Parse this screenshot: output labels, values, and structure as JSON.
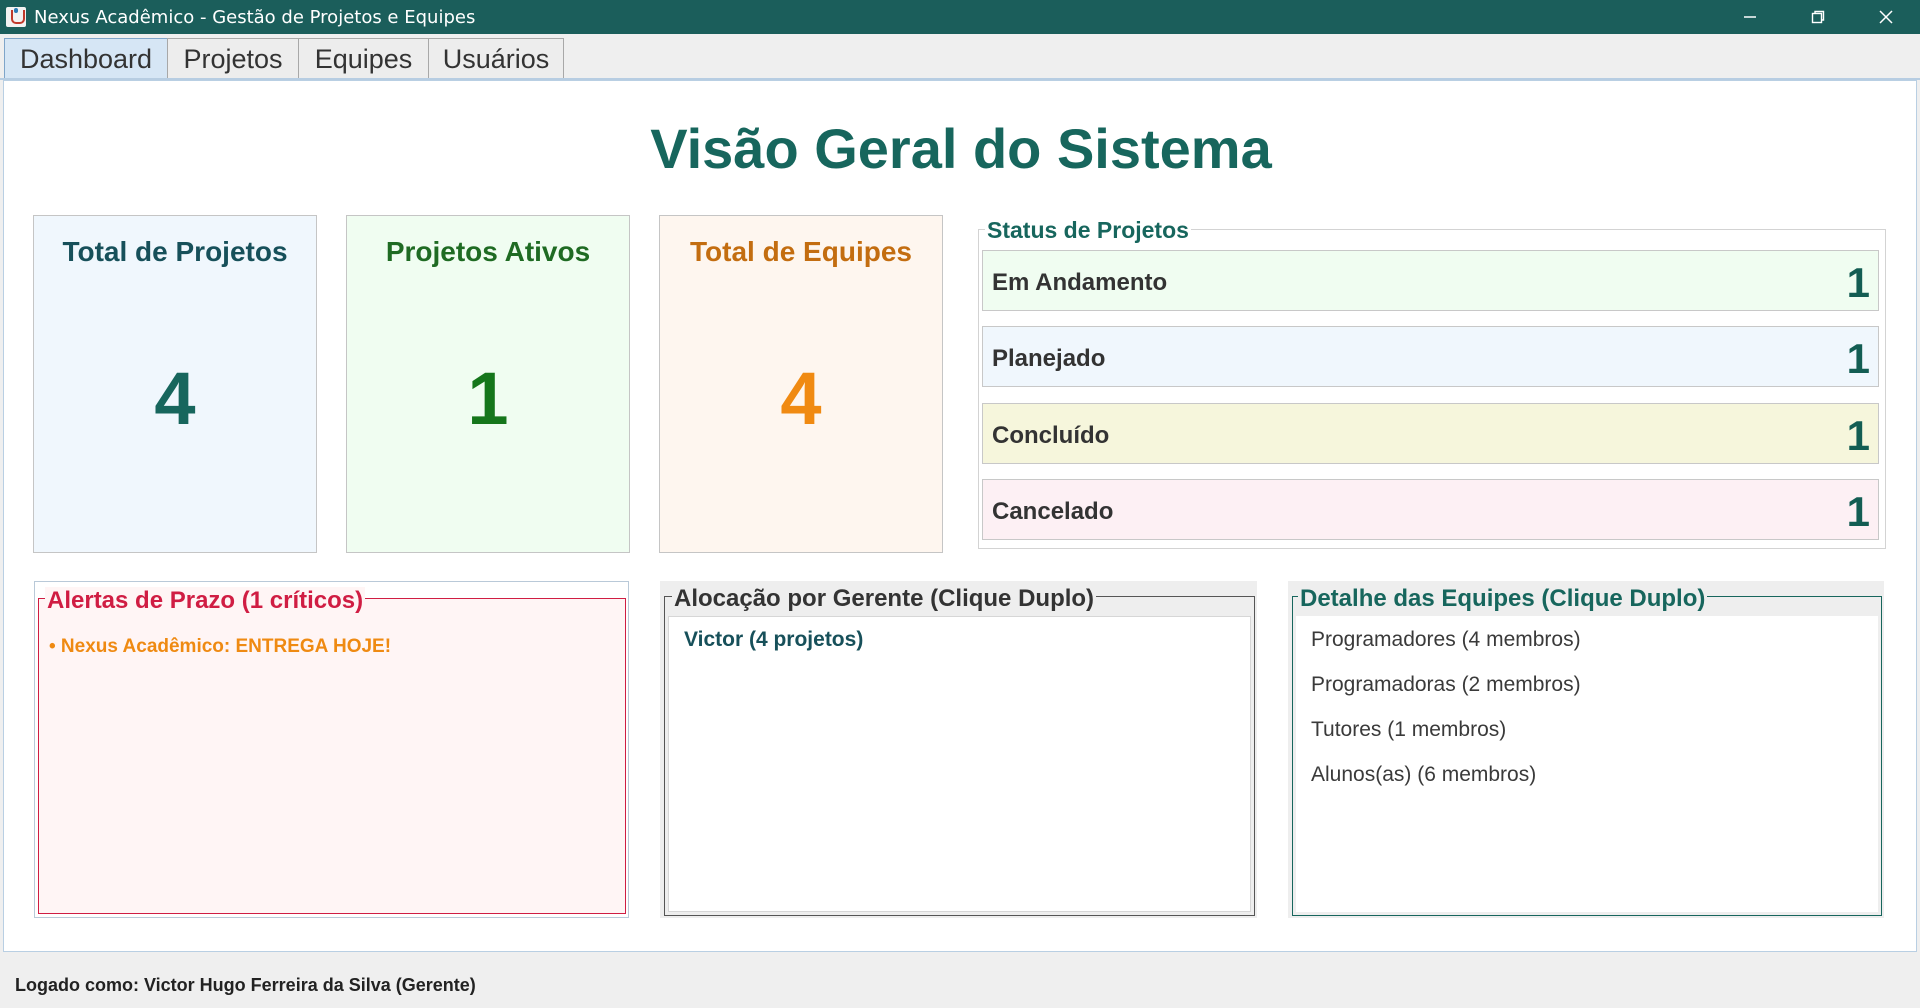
{
  "window": {
    "title": "Nexus Acadêmico - Gestão de Projetos e Equipes"
  },
  "tabs": [
    {
      "label": "Dashboard",
      "active": true
    },
    {
      "label": "Projetos",
      "active": false
    },
    {
      "label": "Equipes",
      "active": false
    },
    {
      "label": "Usuários",
      "active": false
    }
  ],
  "dashboard": {
    "title": "Visão Geral do Sistema",
    "cards": [
      {
        "label": "Total de Projetos",
        "value": "4",
        "bg": "#f0f7fd",
        "labelColor": "#17505a",
        "valueColor": "#17665d"
      },
      {
        "label": "Projetos Ativos",
        "value": "1",
        "bg": "#f0fdf1",
        "labelColor": "#1f6b23",
        "valueColor": "#15761b"
      },
      {
        "label": "Total de Equipes",
        "value": "4",
        "bg": "#fef6ef",
        "labelColor": "#c36d10",
        "valueColor": "#f08a12"
      }
    ],
    "status": {
      "title": "Status de Projetos",
      "rows": [
        {
          "label": "Em Andamento",
          "count": "1",
          "bg": "#f0fdf1"
        },
        {
          "label": "Planejado",
          "count": "1",
          "bg": "#f0f7fd"
        },
        {
          "label": "Concluído",
          "count": "1",
          "bg": "#f6f6dc"
        },
        {
          "label": "Cancelado",
          "count": "1",
          "bg": "#fdf0f4"
        }
      ]
    },
    "alerts": {
      "title": "Alertas de Prazo (1 críticos)",
      "items": [
        "• Nexus Acadêmico: ENTREGA HOJE!"
      ],
      "color": "#d01d43"
    },
    "allocation": {
      "title": "Alocação por Gerente (Clique Duplo)",
      "items": [
        "Victor (4 projetos)"
      ],
      "color": "#333333"
    },
    "teams": {
      "title": "Detalhe das Equipes (Clique Duplo)",
      "items": [
        "Programadores (4 membros)",
        "Programadoras (2 membros)",
        "Tutores (1 membros)",
        "Alunos(as) (6 membros)"
      ],
      "color": "#17665d"
    }
  },
  "footer": {
    "user_text": "Logado como: Victor Hugo Ferreira da Silva (Gerente)"
  }
}
